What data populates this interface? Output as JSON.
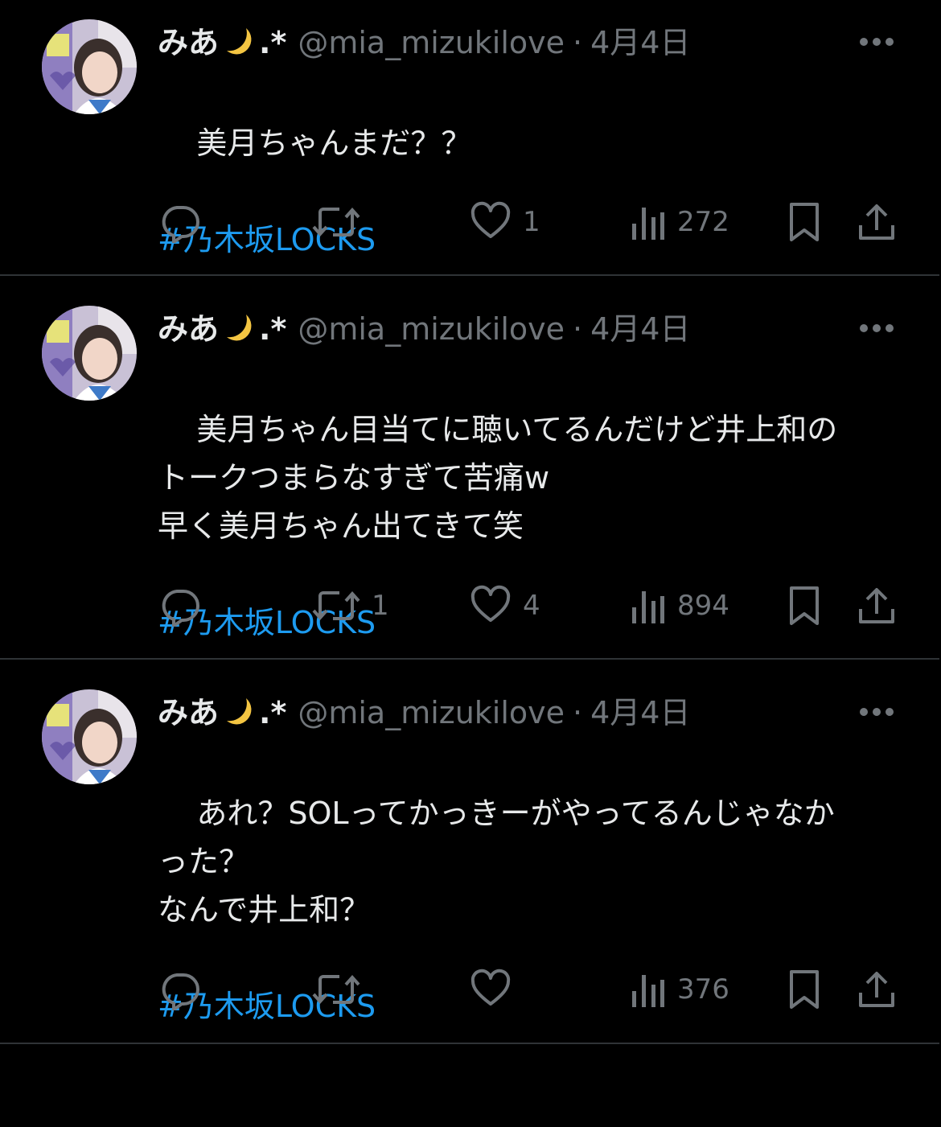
{
  "colors": {
    "background": "#000000",
    "text": "#e7e9ea",
    "muted": "#71767b",
    "hashtag": "#1d9bf0",
    "divider": "#2f3336"
  },
  "tweets": [
    {
      "display_name": "みあ",
      "name_emoji": "moon-icon",
      "name_suffix": ".*",
      "handle": "@mia_mizukilove",
      "separator": "·",
      "date": "4月4日",
      "text": "美月ちゃんまだ？？",
      "hashtag": "#乃木坂LOCKS",
      "reply_count": "",
      "retweet_count": "",
      "like_count": "1",
      "view_count": "272"
    },
    {
      "display_name": "みあ",
      "name_emoji": "moon-icon",
      "name_suffix": ".*",
      "handle": "@mia_mizukilove",
      "separator": "·",
      "date": "4月4日",
      "text": "美月ちゃん目当てに聴いてるんだけど井上和の\nトークつまらなすぎて苦痛w\n早く美月ちゃん出てきて笑",
      "hashtag": "#乃木坂LOCKS",
      "reply_count": "",
      "retweet_count": "1",
      "like_count": "4",
      "view_count": "894"
    },
    {
      "display_name": "みあ",
      "name_emoji": "moon-icon",
      "name_suffix": ".*",
      "handle": "@mia_mizukilove",
      "separator": "·",
      "date": "4月4日",
      "text": "あれ？SOLってかっきーがやってるんじゃなか\nった？\nなんで井上和？",
      "hashtag": "#乃木坂LOCKS",
      "reply_count": "",
      "retweet_count": "",
      "like_count": "",
      "view_count": "376"
    }
  ]
}
